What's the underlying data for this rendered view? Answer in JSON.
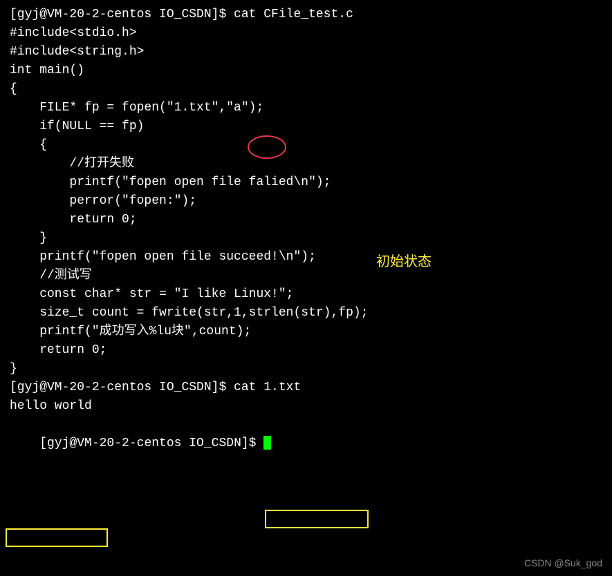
{
  "terminal": {
    "lines": [
      "[gyj@VM-20-2-centos IO_CSDN]$ cat CFile_test.c",
      "#include<stdio.h>",
      "#include<string.h>",
      "",
      "",
      "int main()",
      "{",
      "    FILE* fp = fopen(\"1.txt\",\"a\");",
      "    if(NULL == fp)",
      "    {",
      "        //打开失败",
      "        printf(\"fopen open file falied\\n\");",
      "",
      "        perror(\"fopen:\");",
      "        return 0;",
      "    }",
      "",
      "    printf(\"fopen open file succeed!\\n\");",
      "",
      "    //测试写",
      "    const char* str = \"I like Linux!\";",
      "    size_t count = fwrite(str,1,strlen(str),fp);",
      "    printf(\"成功写入%lu块\",count);",
      "",
      "",
      "    return 0;",
      "}",
      "[gyj@VM-20-2-centos IO_CSDN]$ cat 1.txt ",
      "hello world",
      "[gyj@VM-20-2-centos IO_CSDN]$ "
    ]
  },
  "annotations": {
    "circle_target": "\"a\"",
    "label_text": "初始状态",
    "highlight_cmd": "cat 1.txt",
    "highlight_output": "hello world"
  },
  "watermark": "CSDN @Suk_god"
}
